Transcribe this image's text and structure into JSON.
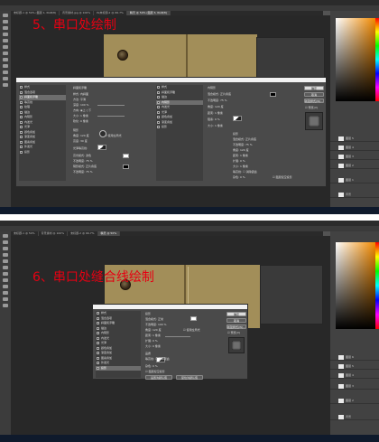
{
  "app": "Adobe Photoshop",
  "step5": {
    "heading": "5、串口处绘制",
    "tabs": [
      "未标题-1 @ 50% (图层 1, RGB/8)",
      "背景素材.jpg @ 100%",
      "Ps未标题-2 @ 66.7%",
      "精灵 @ 50% (图层 3, RGB/8)"
    ],
    "dialog_title": "图层样式",
    "style_list": [
      {
        "label": "样式",
        "checked": false
      },
      {
        "label": "混合选项",
        "checked": false
      },
      {
        "label": "斜面和浮雕",
        "checked": true
      },
      {
        "label": "等高线",
        "checked": false
      },
      {
        "label": "纹理",
        "checked": false
      },
      {
        "label": "描边",
        "checked": false
      },
      {
        "label": "内阴影",
        "checked": true
      },
      {
        "label": "内发光",
        "checked": false
      },
      {
        "label": "光泽",
        "checked": false
      },
      {
        "label": "颜色叠加",
        "checked": false
      },
      {
        "label": "渐变叠加",
        "checked": false
      },
      {
        "label": "图案叠加",
        "checked": false
      },
      {
        "label": "外发光",
        "checked": false
      },
      {
        "label": "投影",
        "checked": true
      }
    ],
    "bevel_group": {
      "title": "斜面和浮雕",
      "rows": [
        "样式: 内斜面",
        "方法: 平滑",
        "深度: 100 %",
        "方向: ◉上 ○下",
        "大小: 1 像素",
        "软化: 0 像素"
      ]
    },
    "shading_group": {
      "title": "阴影",
      "rows": [
        "角度: 120 度",
        "☑ 使用全局光",
        "高度: 30 度",
        "光泽等高线:",
        "高光模式: 滤色",
        "不透明度: 75 %",
        "阴影模式: 正片叠底",
        "不透明度: 75 %"
      ]
    },
    "inner_shadow_group": {
      "title": "内阴影",
      "rows": [
        "混合模式: 正片叠底",
        "不透明度: 75 %",
        "角度: 120 度",
        "距离: 1 像素",
        "阻塞: 0 %",
        "大小: 1 像素"
      ]
    },
    "drop_shadow_group": {
      "title": "投影",
      "rows": [
        "混合模式: 正片叠底",
        "不透明度: 75 %",
        "角度: 120 度",
        "距离: 1 像素",
        "扩展: 0 %",
        "大小: 1 像素",
        "等高线: ☐ 消除锯齿",
        "杂色: 0 %",
        "☑ 图层挖空投影"
      ]
    },
    "buttons": [
      "确定",
      "取消",
      "新建样式(W)...",
      "☑ 预览(V)"
    ],
    "layers": [
      "图层 5",
      "图层 4",
      "图层 3",
      "图层 2",
      "图层 1",
      "背景"
    ]
  },
  "step6": {
    "heading": "6、串口处缝合线绘制",
    "tabs": [
      "未标题-1 @ 50%",
      "背景素材 @ 100%",
      "未标题-2 @ 66.7%",
      "精灵 @ 50%"
    ],
    "dialog_title": "图层样式",
    "style_list": [
      {
        "label": "样式",
        "checked": false
      },
      {
        "label": "混合选项",
        "checked": false
      },
      {
        "label": "斜面和浮雕",
        "checked": false
      },
      {
        "label": "等高线",
        "checked": false
      },
      {
        "label": "纹理",
        "checked": false
      },
      {
        "label": "描边",
        "checked": false
      },
      {
        "label": "内阴影",
        "checked": false
      },
      {
        "label": "内发光",
        "checked": false
      },
      {
        "label": "光泽",
        "checked": false
      },
      {
        "label": "颜色叠加",
        "checked": false
      },
      {
        "label": "渐变叠加",
        "checked": false
      },
      {
        "label": "图案叠加",
        "checked": false
      },
      {
        "label": "外发光",
        "checked": false
      },
      {
        "label": "投影",
        "checked": true
      }
    ],
    "drop_shadow_group": {
      "title": "投影",
      "rows": [
        "混合模式: 正常",
        "不透明度: 100 %",
        "角度: 120 度",
        "☑ 使用全局光",
        "距离: 1 像素",
        "扩展: 0 %",
        "大小: 0 像素"
      ]
    },
    "quality_group": {
      "title": "品质",
      "rows": [
        "等高线: ☐ 消除锯齿",
        "杂色: 0 %",
        "☑ 图层挖空投影"
      ]
    },
    "footer_buttons": [
      "设置为默认值",
      "复位为默认值"
    ],
    "buttons": [
      "确定",
      "取消",
      "新建样式(W)...",
      "☑ 预览(V)"
    ],
    "layers": [
      "图层 6",
      "图层 5",
      "图层 4",
      "图层 3",
      "图层 2",
      "背景"
    ]
  },
  "colors": {
    "heading": "#e60012",
    "leather": "#a8945e",
    "ps_bg": "#535353"
  }
}
